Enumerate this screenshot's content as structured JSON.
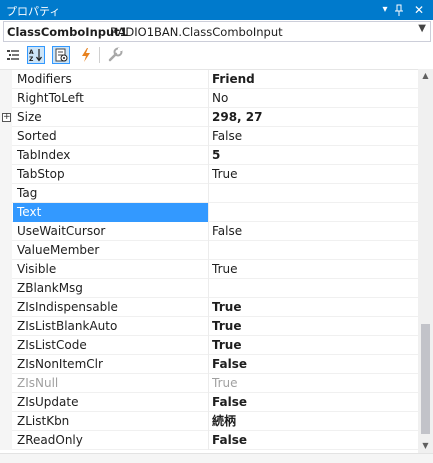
{
  "window": {
    "title": "プロパティ",
    "controls": [
      "chevron-down-icon",
      "pin-icon",
      "close-icon"
    ]
  },
  "object_selector": {
    "name": "ClassComboInput1",
    "type": "RADIO1BAN.ClassComboInput"
  },
  "toolbar": {
    "buttons": [
      {
        "icon": "categorized-icon",
        "active": false
      },
      {
        "icon": "alphabetical-icon",
        "active": true
      },
      {
        "icon": "properties-icon",
        "active": true
      },
      {
        "icon": "events-icon",
        "active": false
      },
      {
        "icon": "property-pages-icon",
        "active": false
      }
    ]
  },
  "properties": [
    {
      "name": "Modifiers",
      "value": "Friend",
      "bold": true
    },
    {
      "name": "RightToLeft",
      "value": "No",
      "bold": false
    },
    {
      "name": "Size",
      "value": "298, 27",
      "bold": true,
      "expandable": true
    },
    {
      "name": "Sorted",
      "value": "False",
      "bold": false
    },
    {
      "name": "TabIndex",
      "value": "5",
      "bold": true
    },
    {
      "name": "TabStop",
      "value": "True",
      "bold": false
    },
    {
      "name": "Tag",
      "value": "",
      "bold": false
    },
    {
      "name": "Text",
      "value": "",
      "bold": false,
      "selected": true
    },
    {
      "name": "UseWaitCursor",
      "value": "False",
      "bold": false
    },
    {
      "name": "ValueMember",
      "value": "",
      "bold": false
    },
    {
      "name": "Visible",
      "value": "True",
      "bold": false
    },
    {
      "name": "ZBlankMsg",
      "value": "",
      "bold": false
    },
    {
      "name": "ZIsIndispensable",
      "value": "True",
      "bold": true
    },
    {
      "name": "ZIsListBlankAuto",
      "value": "True",
      "bold": true
    },
    {
      "name": "ZIsListCode",
      "value": "True",
      "bold": true
    },
    {
      "name": "ZIsNonItemClr",
      "value": "False",
      "bold": true
    },
    {
      "name": "ZIsNull",
      "value": "True",
      "bold": false,
      "disabled": true
    },
    {
      "name": "ZIsUpdate",
      "value": "False",
      "bold": true
    },
    {
      "name": "ZListKbn",
      "value": "続柄",
      "bold": true
    },
    {
      "name": "ZReadOnly",
      "value": "False",
      "bold": true
    }
  ],
  "colors": {
    "titlebar": "#007acc",
    "selection": "#3399ff",
    "events_icon": "#e8821f"
  }
}
